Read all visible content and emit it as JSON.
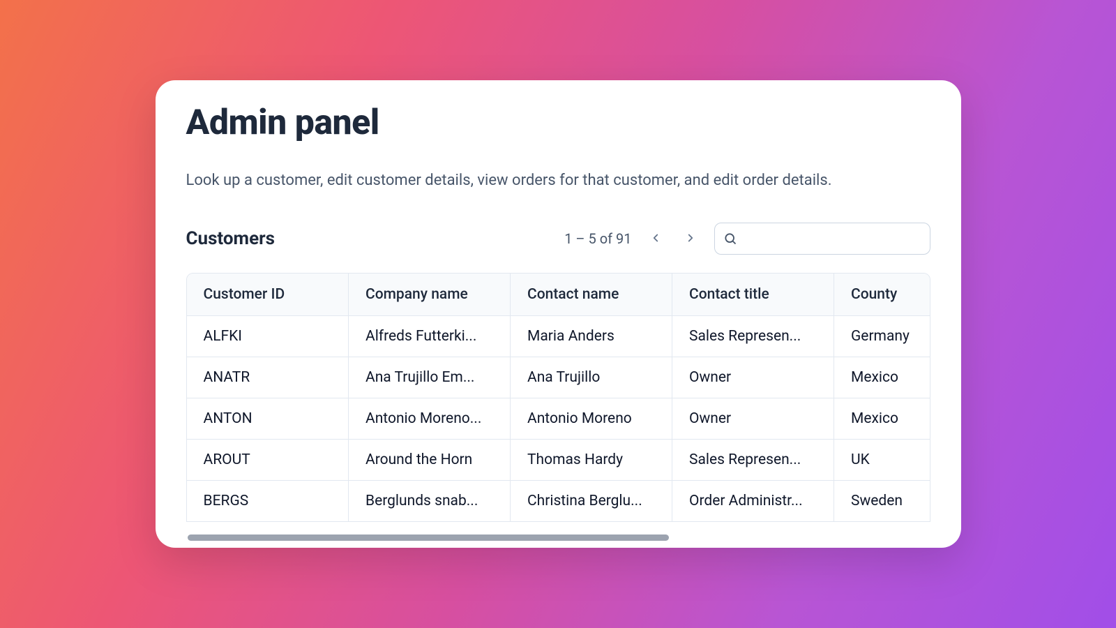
{
  "header": {
    "title": "Admin panel",
    "subtitle": "Look up a customer, edit customer details, view orders for that customer, and edit order details."
  },
  "section": {
    "title": "Customers",
    "pagination_label": "1 – 5 of 91"
  },
  "search": {
    "value": "",
    "placeholder": ""
  },
  "table": {
    "columns": [
      "Customer ID",
      "Company name",
      "Contact name",
      "Contact title",
      "County"
    ],
    "rows": [
      {
        "id": "ALFKI",
        "company": "Alfreds Futterki...",
        "contact": "Maria Anders",
        "title": "Sales Represen...",
        "county": "Germany"
      },
      {
        "id": "ANATR",
        "company": "Ana Trujillo Em...",
        "contact": "Ana Trujillo",
        "title": "Owner",
        "county": "Mexico"
      },
      {
        "id": "ANTON",
        "company": "Antonio Moreno...",
        "contact": "Antonio Moreno",
        "title": "Owner",
        "county": "Mexico"
      },
      {
        "id": "AROUT",
        "company": "Around the Horn",
        "contact": "Thomas Hardy",
        "title": "Sales Represen...",
        "county": "UK"
      },
      {
        "id": "BERGS",
        "company": "Berglunds snab...",
        "contact": "Christina Berglu...",
        "title": "Order Administr...",
        "county": "Sweden"
      }
    ]
  }
}
